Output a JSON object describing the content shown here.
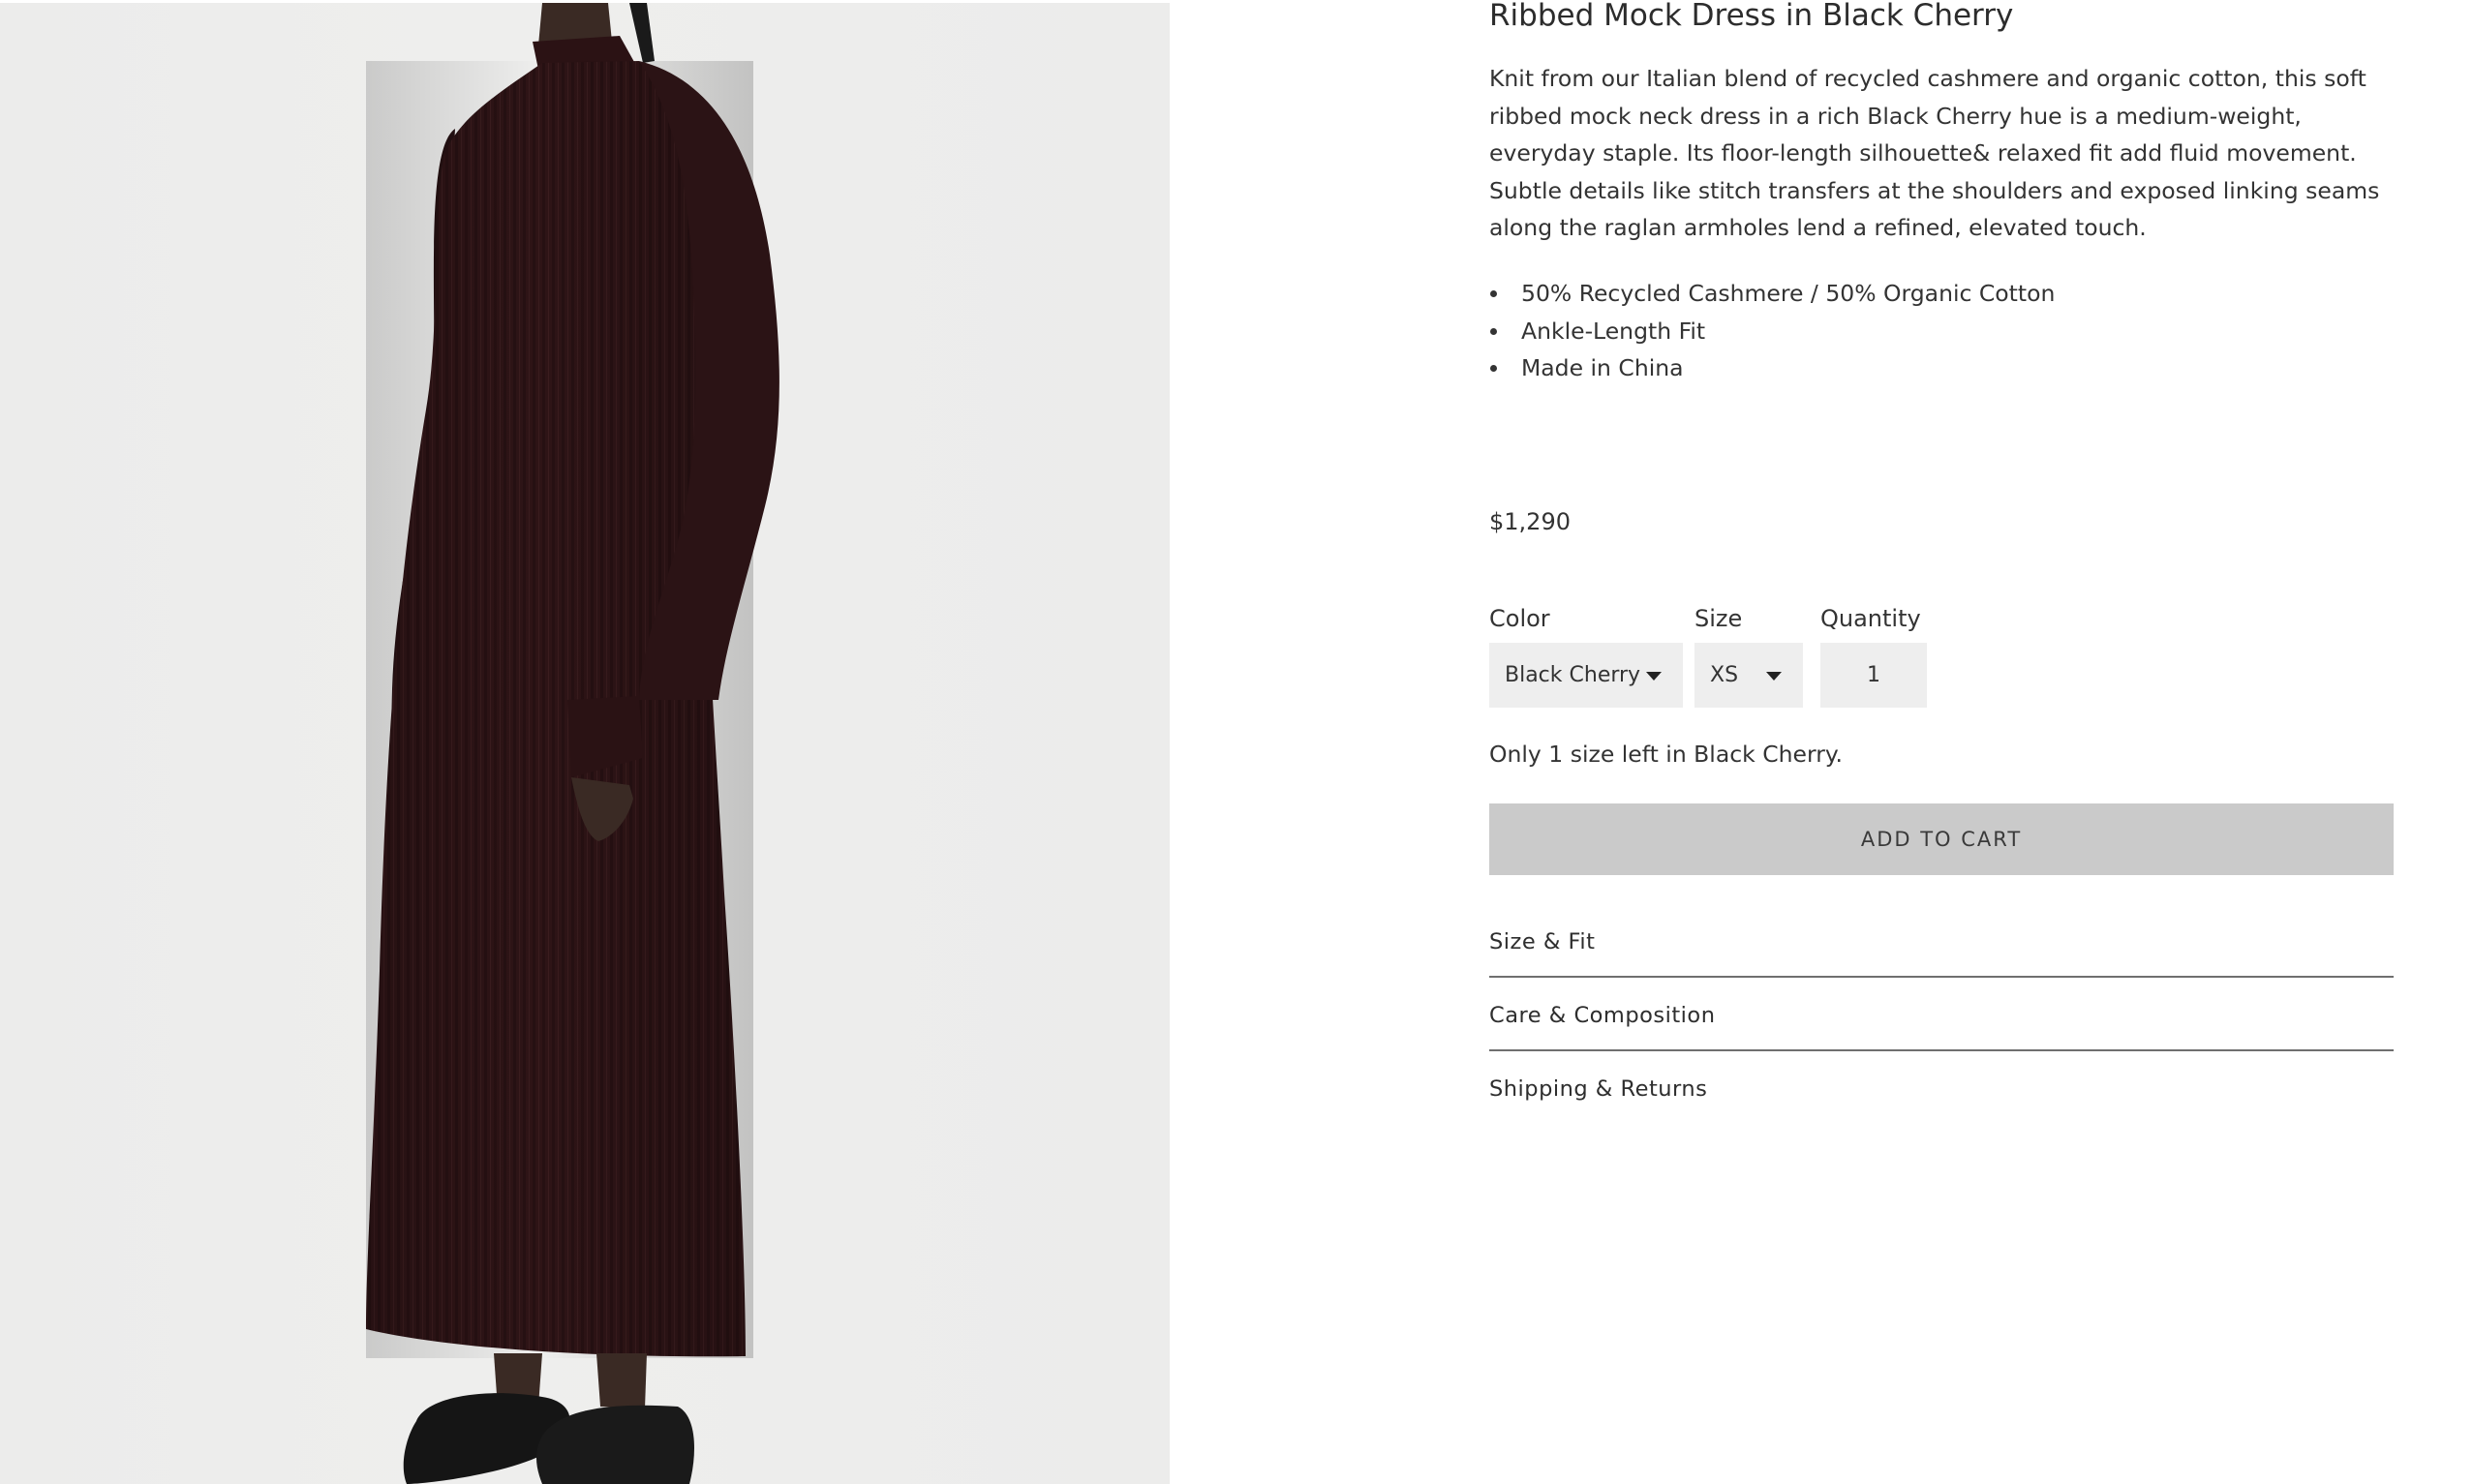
{
  "product": {
    "image_alt": "Model wearing a long black cherry ribbed mock neck knit dress with black loafers",
    "title": "Ribbed Mock Dress in Black Cherry",
    "description": "Knit from our Italian blend of recycled cashmere and organic cotton, this soft ribbed mock neck dress in a rich Black Cherry hue is a medium-weight, everyday staple. Its floor-length silhouette& relaxed fit add fluid movement. Subtle details like stitch transfers at the shoulders and exposed linking seams along the raglan armholes lend a refined, elevated touch.",
    "features": [
      "50% Recycled Cashmere / 50% Organic Cotton",
      "Ankle-Length Fit",
      "Made in China"
    ],
    "price": "$1,290"
  },
  "options": {
    "color_label": "Color",
    "color_value": "Black Cherry",
    "size_label": "Size",
    "size_value": "XS",
    "quantity_label": "Quantity",
    "quantity_value": "1"
  },
  "stock_message": "Only 1 size left in Black Cherry.",
  "add_to_cart_label": "ADD TO CART",
  "accordion": [
    {
      "label": "Size & Fit"
    },
    {
      "label": "Care & Composition"
    },
    {
      "label": "Shipping & Returns"
    }
  ],
  "colors": {
    "dress": "#2e1416",
    "photo_background": "#ececeb",
    "button_background": "#cacaca",
    "select_background": "#eeeeee"
  },
  "icons": {
    "select_caret": "chevron-down-icon"
  }
}
